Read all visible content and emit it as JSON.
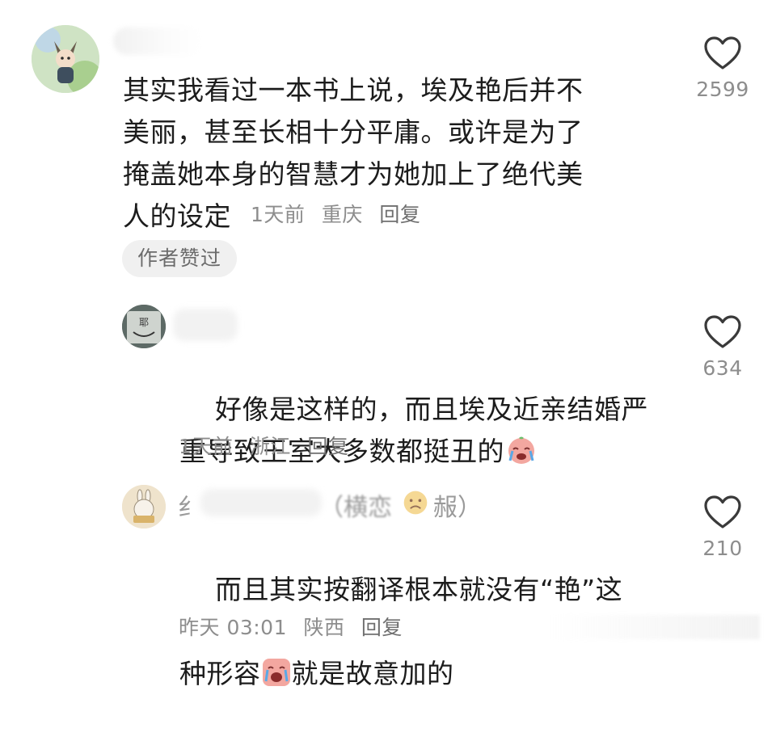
{
  "comments": [
    {
      "text": "其实我看过一本书上说，埃及艳后并不\n美丽，甚至长相十分平庸。或许是为了\n掩盖她本身的智慧才为她加上了绝代美\n人的设定",
      "time": "1天前",
      "location": "重庆",
      "reply_label": "回复",
      "badge": "作者赞过",
      "likes": "2599"
    },
    {
      "text": "好像是这样的，而且埃及近亲结婚严\n重导致王室大多数都挺丑的",
      "time": "1天前",
      "location": "浙江",
      "reply_label": "回复",
      "likes": "634"
    },
    {
      "name_visible_left": "纟",
      "name_visible_right": "（横恋",
      "name_visible_end": "赧）",
      "text_line1": "而且其实按翻译根本就没有“艳”这",
      "text_line2a": "种形容",
      "text_line2b": "就是故意加的",
      "time": "昨天 03:01",
      "location": "陕西",
      "reply_label": "回复",
      "likes": "210"
    }
  ],
  "icons": {
    "like": "heart-outline-icon",
    "crying_emoji": "crying-face-emoji"
  },
  "colors": {
    "meta": "#8d8d8d",
    "badge_bg": "#f0f0f0"
  }
}
